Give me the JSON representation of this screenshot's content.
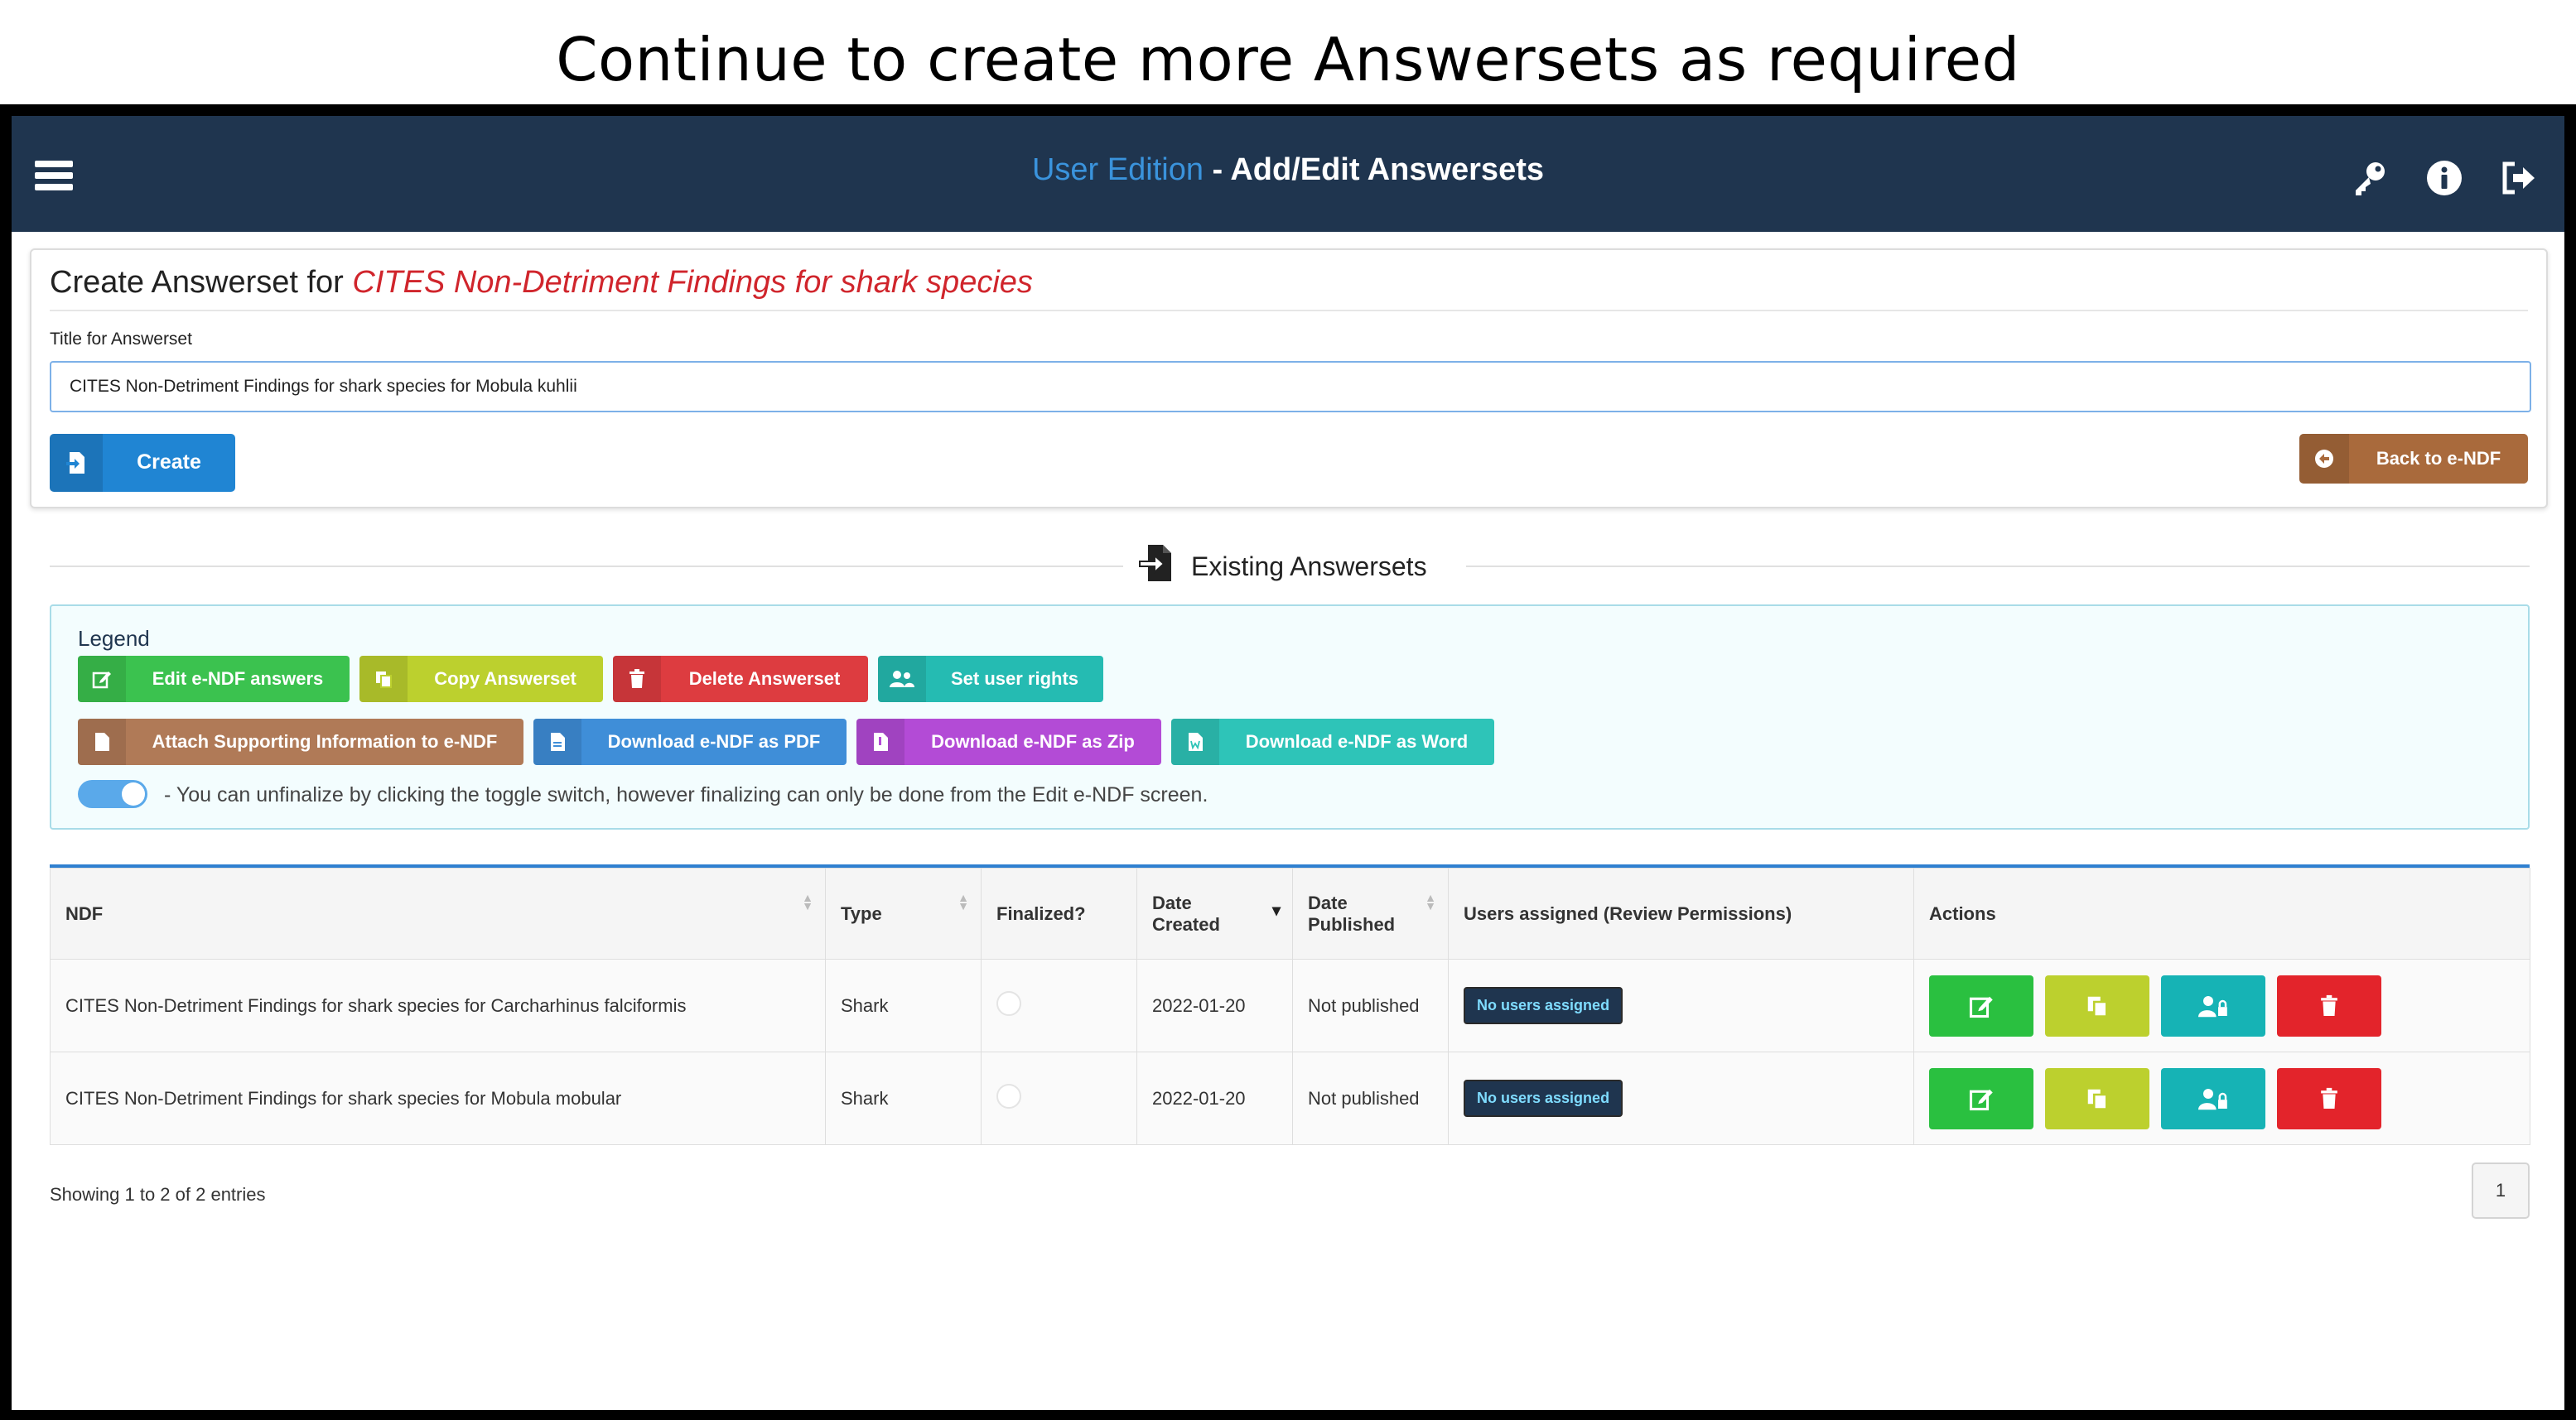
{
  "slide": {
    "title": "Continue to create more Answersets as required"
  },
  "navbar": {
    "edition": "User Edition",
    "page": " - Add/Edit Answersets",
    "icons": [
      "menu-icon",
      "key-icon",
      "info-icon",
      "sign-out-icon"
    ]
  },
  "create_card": {
    "heading_prefix": "Create Answerset for ",
    "ndf_name": "CITES Non-Detriment Findings for shark species",
    "field_label": "Title for Answerset",
    "title_value": "CITES Non-Detriment Findings for shark species for Mobula kuhlii",
    "create_label": "Create",
    "back_label": "Back to e-NDF"
  },
  "existing": {
    "heading": "Existing Answersets"
  },
  "legend": {
    "title": "Legend",
    "row1": [
      {
        "label": "Edit e-NDF answers",
        "icon": "edit-icon",
        "color": "#3bc24f"
      },
      {
        "label": "Copy Answerset",
        "icon": "copy-icon",
        "color": "#bcd02e"
      },
      {
        "label": "Delete Answerset",
        "icon": "trash-icon",
        "color": "#dd3c40"
      },
      {
        "label": "Set user rights",
        "icon": "users-icon",
        "color": "#25bbb2"
      }
    ],
    "row2": [
      {
        "label": "Attach Supporting Information to e-NDF",
        "icon": "file-icon",
        "color": "#b07a57"
      },
      {
        "label": "Download e-NDF as PDF",
        "icon": "pdf-file-icon",
        "color": "#3f8ed8"
      },
      {
        "label": "Download e-NDF as Zip",
        "icon": "zip-file-icon",
        "color": "#b34bd6"
      },
      {
        "label": "Download e-NDF as Word",
        "icon": "word-file-icon",
        "color": "#2ec4b8"
      }
    ],
    "toggle_note": "- You can unfinalize by clicking the toggle switch, however finalizing can only be done from the Edit e-NDF screen."
  },
  "table": {
    "headers": {
      "ndf": "NDF",
      "type": "Type",
      "finalized": "Finalized?",
      "date_created_1": "Date",
      "date_created_2": "Created",
      "date_published_1": "Date",
      "date_published_2": "Published",
      "users": "Users assigned (Review Permissions)",
      "actions": "Actions"
    },
    "rows": [
      {
        "ndf": "CITES Non-Detriment Findings for shark species for Carcharhinus falciformis",
        "type": "Shark",
        "finalized": false,
        "date_created": "2022-01-20",
        "date_published": "Not published",
        "users": "No users assigned"
      },
      {
        "ndf": "CITES Non-Detriment Findings for shark species for Mobula mobular",
        "type": "Shark",
        "finalized": false,
        "date_created": "2022-01-20",
        "date_published": "Not published",
        "users": "No users assigned"
      }
    ],
    "showing": "Showing 1 to 2 of 2 entries",
    "page": "1"
  }
}
